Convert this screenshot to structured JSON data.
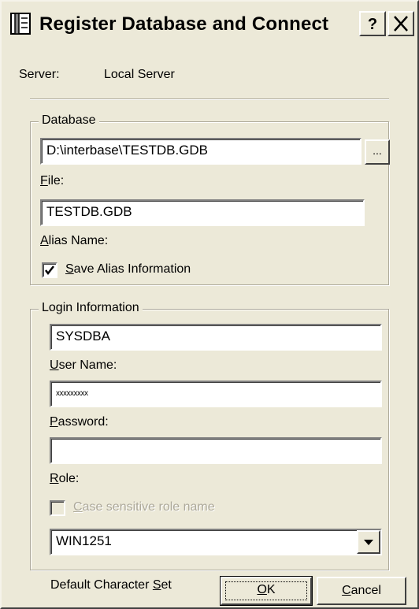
{
  "window": {
    "title": "Register Database and Connect",
    "help_glyph": "?",
    "close_glyph": "X"
  },
  "server": {
    "label": "Server:",
    "value": "Local Server"
  },
  "database_group": {
    "legend": "Database",
    "path_value": "D:\\interbase\\TESTDB.GDB",
    "browse_label": "...",
    "file_label_u": "F",
    "file_label_rest": "ile:",
    "alias_value": "TESTDB.GDB",
    "alias_label_u": "A",
    "alias_label_rest": "lias Name:",
    "save_alias_checked": true,
    "save_alias_label_u": "S",
    "save_alias_label_rest": "ave Alias Information"
  },
  "login_group": {
    "legend": "Login Information",
    "user_value": "SYSDBA",
    "user_label_u": "U",
    "user_label_rest": "ser Name:",
    "password_value": "xxxxxxxxx",
    "password_label_u": "P",
    "password_label_rest": "assword:",
    "role_value": "",
    "role_label_u": "R",
    "role_label_rest": "ole:",
    "case_sensitive_checked": false,
    "case_sensitive_label_u": "C",
    "case_sensitive_label_rest": "ase sensitive role name",
    "charset_value": "WIN1251",
    "charset_label_pre": "Default Character ",
    "charset_label_u": "S",
    "charset_label_rest": "et"
  },
  "buttons": {
    "ok_u": "O",
    "ok_rest": "K",
    "cancel_u": "C",
    "cancel_rest": "ancel"
  },
  "colors": {
    "face": "#ece9d8",
    "disabled_text": "#aca899"
  }
}
